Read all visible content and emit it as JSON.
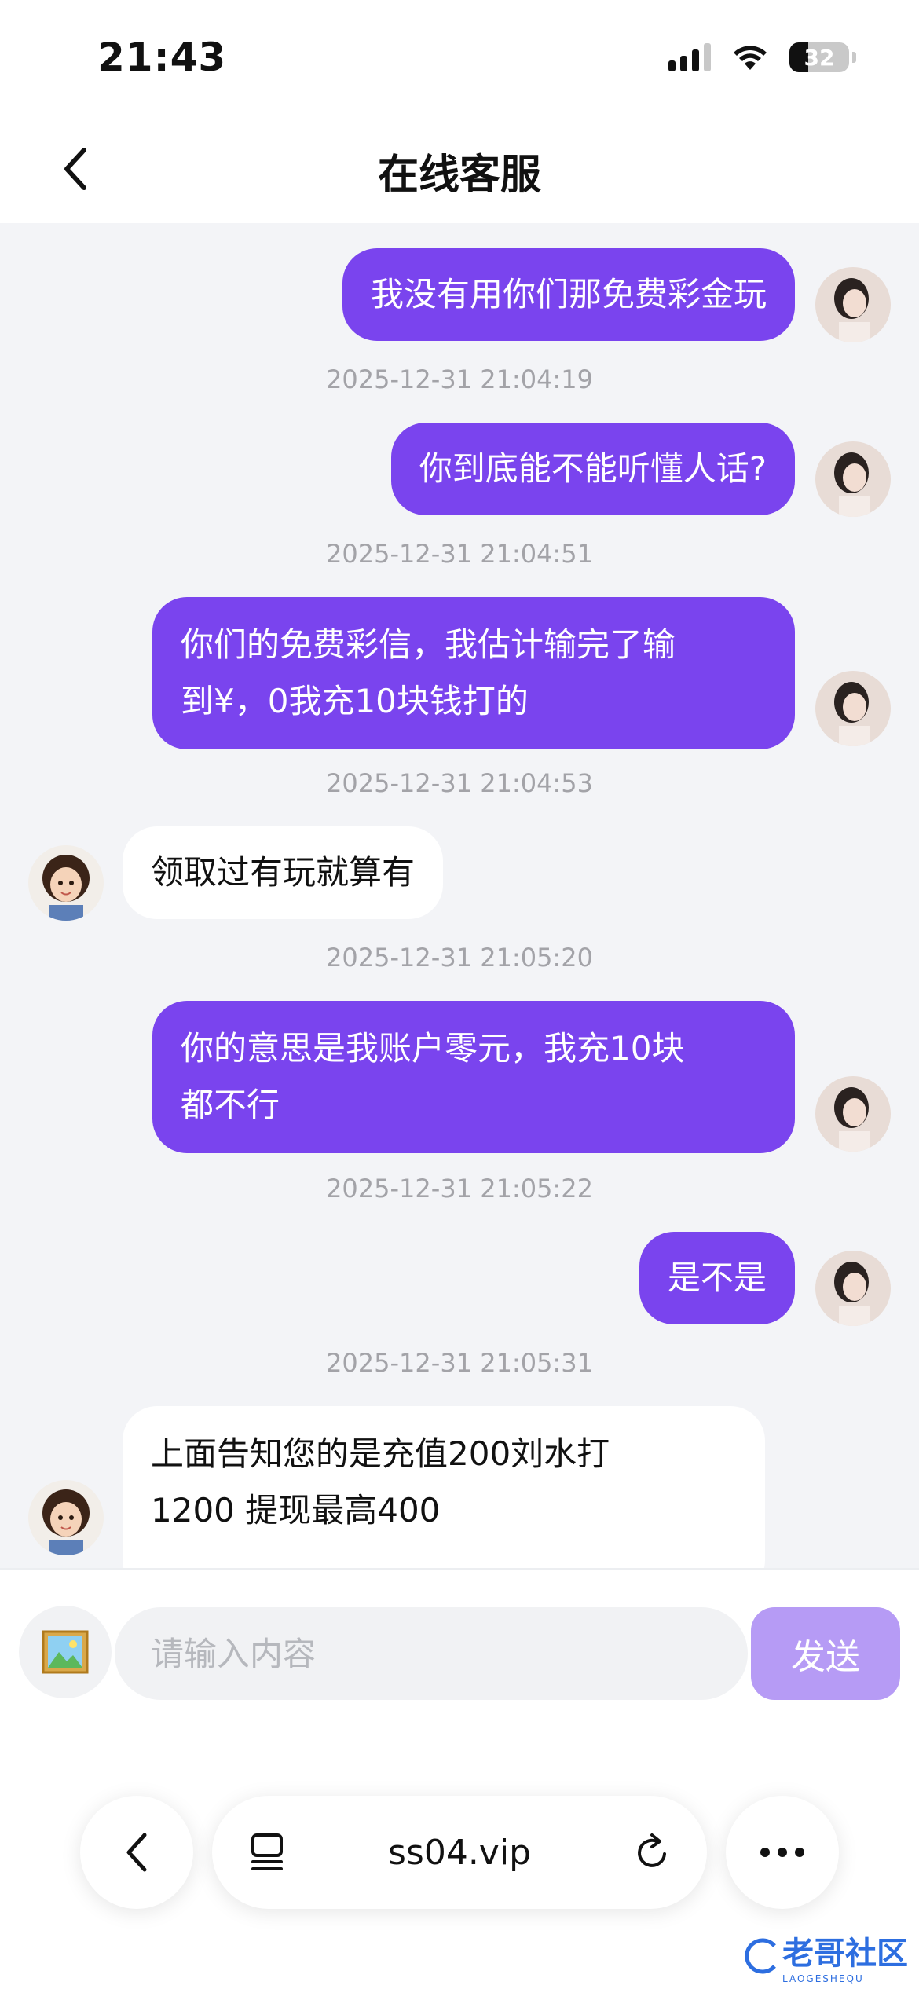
{
  "status_bar": {
    "time": "21:43",
    "battery": "32"
  },
  "header": {
    "title": "在线客服"
  },
  "messages": [
    {
      "side": "out",
      "text": "我没有用你们那免费彩金玩"
    },
    {
      "timestamp": "2025-12-31 21:04:19"
    },
    {
      "side": "out",
      "text": "你到底能不能听懂人话?"
    },
    {
      "timestamp": "2025-12-31 21:04:51"
    },
    {
      "side": "out",
      "line1": "你们的免费彩信，我估计输完了输",
      "line2": "到¥，0我充10块钱打的"
    },
    {
      "timestamp": "2025-12-31 21:04:53"
    },
    {
      "side": "in",
      "text": "领取过有玩就算有"
    },
    {
      "timestamp": "2025-12-31 21:05:20"
    },
    {
      "side": "out",
      "line1": "你的意思是我账户零元，我充10块",
      "line2": "都不行"
    },
    {
      "timestamp": "2025-12-31 21:05:22"
    },
    {
      "side": "out",
      "text": "是不是"
    },
    {
      "timestamp": "2025-12-31 21:05:31"
    },
    {
      "side": "in",
      "line1": "上面告知您的是充值200刘水打",
      "line2": "1200 提现最高400"
    }
  ],
  "input": {
    "placeholder": "请输入内容",
    "send_label": "发送"
  },
  "browser": {
    "url": "ss04.vip"
  },
  "watermark": {
    "text": "老哥社区",
    "sub": "LAOGESHEQU"
  },
  "colors": {
    "accent": "#7a44ee",
    "send_disabled": "#b69bf5",
    "chat_bg": "#f3f4f7"
  }
}
